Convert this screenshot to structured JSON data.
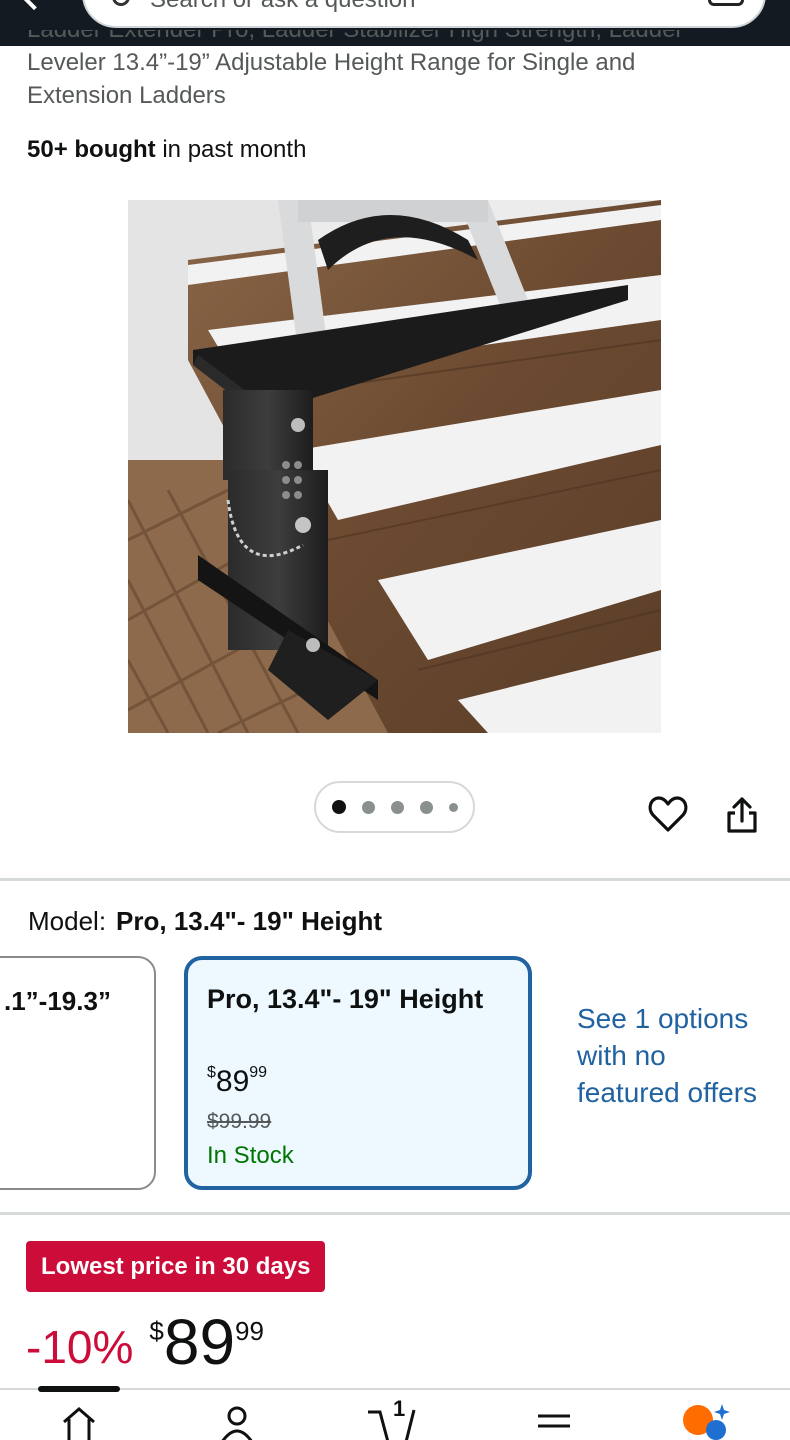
{
  "header": {
    "search_placeholder": "Search or ask a question"
  },
  "product": {
    "title_line_cut": "Ladder Extender Pro, Ladder Stabilizer High Strength, Ladder",
    "title_line_2": "Leveler 13.4”-19” Adjustable Height Range for Single and",
    "title_line_3": "Extension Ladders",
    "bought_bold": "50+ bought",
    "bought_rest": " in past month"
  },
  "gallery": {
    "image_count": 5,
    "active_index": 0
  },
  "model": {
    "label": "Model:",
    "selected_value": "Pro, 13.4\"- 19\" Height",
    "options": [
      {
        "title": ".1”-19.3”"
      },
      {
        "title": "Pro, 13.4\"- 19\" Height",
        "currency": "$",
        "price_whole": "89",
        "price_fraction": "99",
        "list_price": "$99.99",
        "availability": "In Stock"
      }
    ],
    "see_more": "See 1 options with no featured offers"
  },
  "pricing": {
    "deal_badge": "Lowest price in 30 days",
    "discount": "-10%",
    "currency": "$",
    "price_whole": "89",
    "price_fraction": "99"
  },
  "colors": {
    "deal_red": "#cc0c39",
    "link_blue": "#2162a1",
    "stock_green": "#007600",
    "selected_bg": "#edf8ff"
  },
  "bottom_nav": {
    "items": [
      "home-icon",
      "account-icon",
      "cart-icon",
      "menu-icon",
      "ai-assistant-icon"
    ],
    "cart_count": "1"
  }
}
